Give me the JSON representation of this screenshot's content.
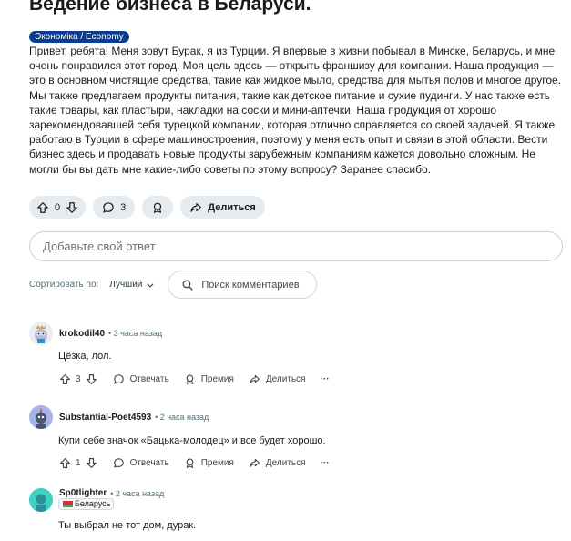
{
  "post": {
    "title": "Ведение бизнеса в Беларуси.",
    "flair": "Экономіка / Economy",
    "body": "Привет, ребята! Меня зовут Бурак, я из Турции. Я впервые в жизни побывал в Минске, Беларусь, и мне очень понравился этот город. Моя цель здесь — открыть франшизу для компании. Наша продукция — это в основном чистящие средства, такие как жидкое мыло, средства для мытья полов и многое другое. Мы также предлагаем продукты питания, такие как детское питание и сухие пудинги. У нас также есть такие товары, как пластыри, накладки на соски и мини-аптечки. Наша продукция от хорошо зарекомендовавшей себя турецкой компании, которая отлично справляется со своей задачей. Я также работаю в Турции в сфере машиностроения, поэтому у меня есть опыт и связи в этой области. Вести бизнес здесь и продавать новые продукты зарубежным компаниям кажется довольно сложным. Не могли бы вы дать мне какие-либо советы по этому вопросу? Заранее спасибо.",
    "score": "0",
    "comments_count": "3",
    "share_label": "Делиться"
  },
  "answer": {
    "placeholder": "Добавьте свой ответ"
  },
  "sort": {
    "label": "Сортировать по:",
    "value": "Лучший",
    "search_placeholder": "Поиск комментариев"
  },
  "comments": [
    {
      "author": "krokodil40",
      "time": "• 3 часа назад",
      "text": "Цёзка, лол.",
      "score": "3",
      "reply": "Отвечать",
      "award": "Премия",
      "share": "Делиться",
      "more": "···"
    },
    {
      "author": "Substantial-Poet4593",
      "time": "• 2 часа назад",
      "text": "Купи себе значок «Бацька-молодец» и все будет хорошо.",
      "score": "1",
      "reply": "Отвечать",
      "award": "Премия",
      "share": "Делиться",
      "more": "···"
    },
    {
      "author": "Sp0tlighter",
      "time": "• 2 часа назад",
      "flair": "Беларусь",
      "text": "Ты выбрал не тот дом, дурак."
    }
  ],
  "icons": {
    "upvote": "arrow-up-icon",
    "downvote": "arrow-down-icon",
    "comment": "comment-bubble-icon",
    "award": "award-icon",
    "share": "share-arrow-icon",
    "search": "search-icon",
    "chevron": "chevron-down-icon"
  },
  "colors": {
    "flair_bg": "#0a3d91",
    "pill_bg": "#e5ebee"
  }
}
